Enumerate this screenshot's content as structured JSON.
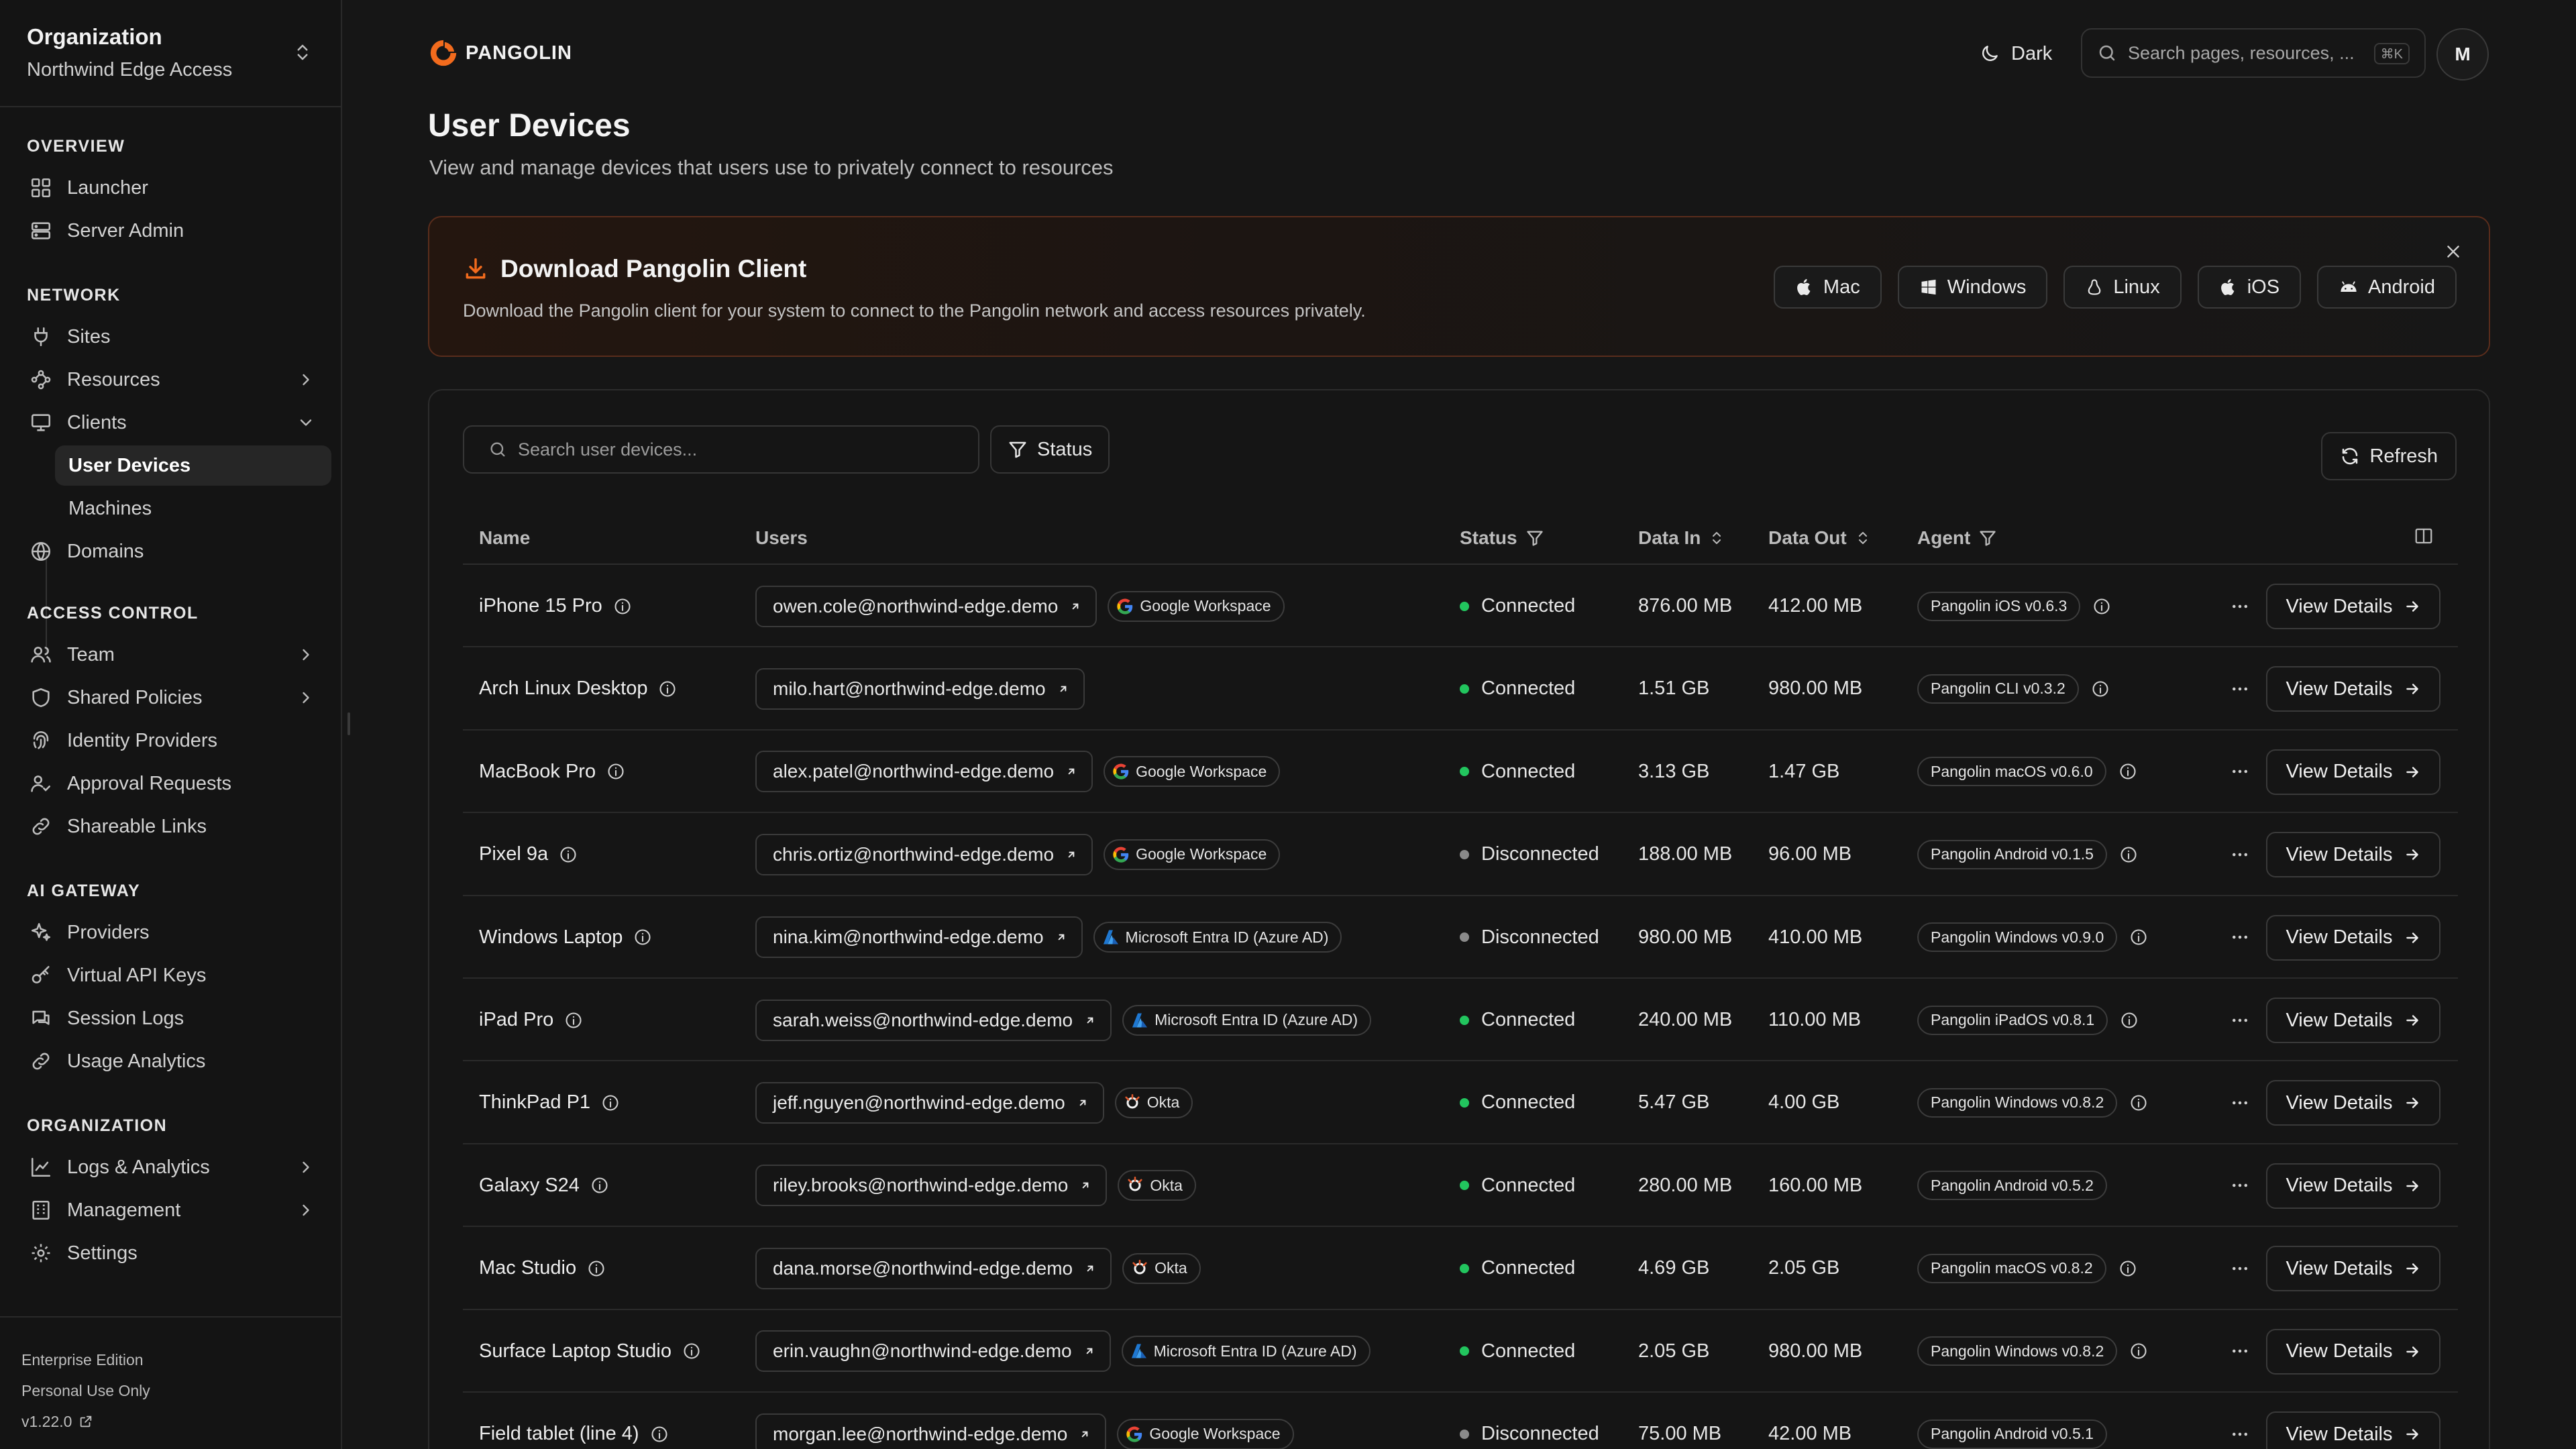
{
  "org": {
    "title": "Organization",
    "name": "Northwind Edge Access"
  },
  "nav": {
    "overview": "OVERVIEW",
    "launcher": "Launcher",
    "server_admin": "Server Admin",
    "network": "NETWORK",
    "sites": "Sites",
    "resources": "Resources",
    "clients": "Clients",
    "user_devices": "User Devices",
    "machines": "Machines",
    "domains": "Domains",
    "access_control": "ACCESS CONTROL",
    "team": "Team",
    "shared_policies": "Shared Policies",
    "identity_providers": "Identity Providers",
    "approval_requests": "Approval Requests",
    "shareable_links": "Shareable Links",
    "ai_gateway": "AI GATEWAY",
    "providers": "Providers",
    "virtual_api_keys": "Virtual API Keys",
    "session_logs": "Session Logs",
    "usage_analytics": "Usage Analytics",
    "organization": "ORGANIZATION",
    "logs_analytics": "Logs & Analytics",
    "management": "Management",
    "settings": "Settings"
  },
  "footer": {
    "edition": "Enterprise Edition",
    "license": "Personal Use Only",
    "version": "v1.22.0"
  },
  "topbar": {
    "brand": "PANGOLIN",
    "theme": "Dark",
    "search_placeholder": "Search pages, resources, ...",
    "search_shortcut": "⌘K",
    "avatar": "M"
  },
  "page": {
    "title": "User Devices",
    "description": "View and manage devices that users use to privately connect to resources"
  },
  "banner": {
    "title": "Download Pangolin Client",
    "description": "Download the Pangolin client for your system to connect to the Pangolin network and access resources privately.",
    "buttons": [
      "Mac",
      "Windows",
      "Linux",
      "iOS",
      "Android"
    ]
  },
  "table": {
    "search_placeholder": "Search user devices...",
    "status_filter": "Status",
    "refresh": "Refresh",
    "headers": {
      "name": "Name",
      "users": "Users",
      "status": "Status",
      "data_in": "Data In",
      "data_out": "Data Out",
      "agent": "Agent"
    },
    "view_label": "View Details",
    "rows": [
      {
        "name": "iPhone 15 Pro",
        "user": "owen.cole@northwind-edge.demo",
        "idp": "Google Workspace",
        "idp_icon": "google-icon",
        "status": "Connected",
        "data_in": "876.00 MB",
        "data_out": "412.00 MB",
        "agent": "Pangolin iOS v0.6.3",
        "agent_info": true
      },
      {
        "name": "Arch Linux Desktop",
        "user": "milo.hart@northwind-edge.demo",
        "idp": "",
        "idp_icon": "",
        "status": "Connected",
        "data_in": "1.51 GB",
        "data_out": "980.00 MB",
        "agent": "Pangolin CLI v0.3.2",
        "agent_info": true
      },
      {
        "name": "MacBook Pro",
        "user": "alex.patel@northwind-edge.demo",
        "idp": "Google Workspace",
        "idp_icon": "google-icon",
        "status": "Connected",
        "data_in": "3.13 GB",
        "data_out": "1.47 GB",
        "agent": "Pangolin macOS v0.6.0",
        "agent_info": true
      },
      {
        "name": "Pixel 9a",
        "user": "chris.ortiz@northwind-edge.demo",
        "idp": "Google Workspace",
        "idp_icon": "google-icon",
        "status": "Disconnected",
        "data_in": "188.00 MB",
        "data_out": "96.00 MB",
        "agent": "Pangolin Android v0.1.5",
        "agent_info": true
      },
      {
        "name": "Windows Laptop",
        "user": "nina.kim@northwind-edge.demo",
        "idp": "Microsoft Entra ID (Azure AD)",
        "idp_icon": "azure-icon",
        "status": "Disconnected",
        "data_in": "980.00 MB",
        "data_out": "410.00 MB",
        "agent": "Pangolin Windows v0.9.0",
        "agent_info": true
      },
      {
        "name": "iPad Pro",
        "user": "sarah.weiss@northwind-edge.demo",
        "idp": "Microsoft Entra ID (Azure AD)",
        "idp_icon": "azure-icon",
        "status": "Connected",
        "data_in": "240.00 MB",
        "data_out": "110.00 MB",
        "agent": "Pangolin iPadOS v0.8.1",
        "agent_info": true
      },
      {
        "name": "ThinkPad P1",
        "user": "jeff.nguyen@northwind-edge.demo",
        "idp": "Okta",
        "idp_icon": "okta-icon",
        "status": "Connected",
        "data_in": "5.47 GB",
        "data_out": "4.00 GB",
        "agent": "Pangolin Windows v0.8.2",
        "agent_info": true
      },
      {
        "name": "Galaxy S24",
        "user": "riley.brooks@northwind-edge.demo",
        "idp": "Okta",
        "idp_icon": "okta-icon",
        "status": "Connected",
        "data_in": "280.00 MB",
        "data_out": "160.00 MB",
        "agent": "Pangolin Android v0.5.2",
        "agent_info": false
      },
      {
        "name": "Mac Studio",
        "user": "dana.morse@northwind-edge.demo",
        "idp": "Okta",
        "idp_icon": "okta-icon",
        "status": "Connected",
        "data_in": "4.69 GB",
        "data_out": "2.05 GB",
        "agent": "Pangolin macOS v0.8.2",
        "agent_info": true
      },
      {
        "name": "Surface Laptop Studio",
        "user": "erin.vaughn@northwind-edge.demo",
        "idp": "Microsoft Entra ID (Azure AD)",
        "idp_icon": "azure-icon",
        "status": "Connected",
        "data_in": "2.05 GB",
        "data_out": "980.00 MB",
        "agent": "Pangolin Windows v0.8.2",
        "agent_info": true
      },
      {
        "name": "Field tablet (line 4)",
        "user": "morgan.lee@northwind-edge.demo",
        "idp": "Google Workspace",
        "idp_icon": "google-icon",
        "status": "Disconnected",
        "data_in": "75.00 MB",
        "data_out": "42.00 MB",
        "agent": "Pangolin Android v0.5.1",
        "agent_info": false
      }
    ]
  },
  "colors": {
    "accent": "#f26b1d",
    "connected": "#22c55e",
    "disconnected": "#8a8a8a",
    "background": "#161616"
  }
}
